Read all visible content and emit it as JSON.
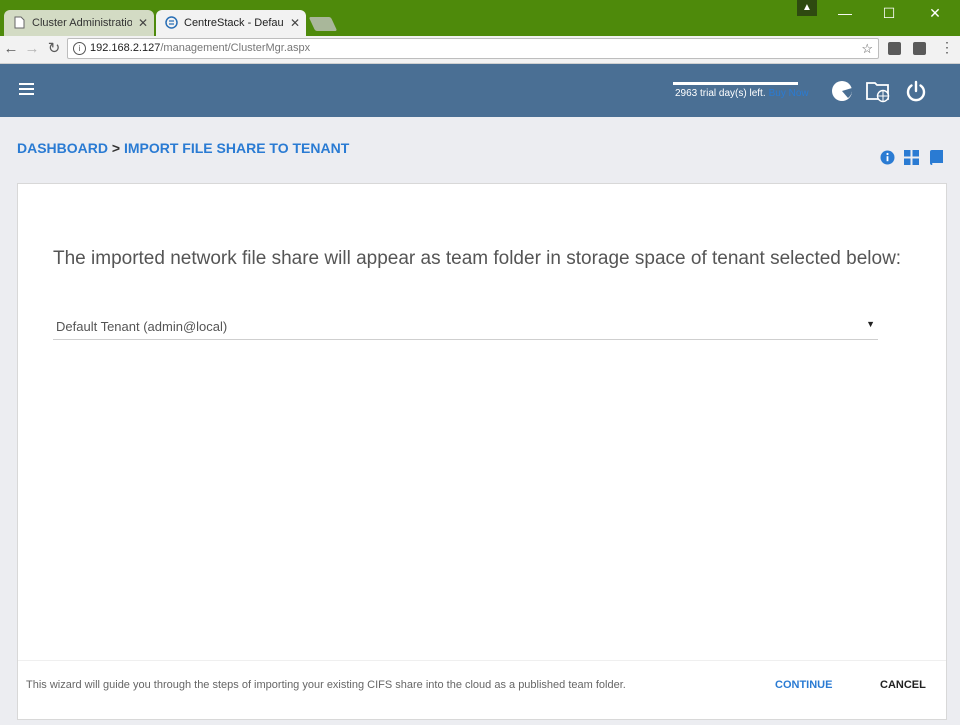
{
  "browser": {
    "tabs": [
      {
        "title": "Cluster Administration –",
        "active": false,
        "icon": "page-icon"
      },
      {
        "title": "CentreStack - Default Clu",
        "active": true,
        "icon": "centrestack-icon"
      }
    ],
    "address": {
      "host": "192.168.2.127",
      "path": "/management/ClusterMgr.aspx"
    }
  },
  "header": {
    "trial_text": "2963 trial day(s) left.",
    "trial_link": "Buy Now",
    "icons": [
      "report-icon",
      "folder-globe-icon",
      "power-icon"
    ]
  },
  "breadcrumb": {
    "root": "DASHBOARD",
    "separator": ">",
    "current": "IMPORT FILE SHARE TO TENANT"
  },
  "main": {
    "heading": "The imported network file share will appear as team folder in storage space of tenant selected below:",
    "tenant_select": {
      "value": "Default Tenant (admin@local)"
    }
  },
  "footer": {
    "note": "This wizard will guide you through the steps of importing your existing CIFS share into the cloud as a published team folder.",
    "continue_label": "CONTINUE",
    "cancel_label": "CANCEL"
  },
  "colors": {
    "titlebar": "#4e8a0b",
    "header": "#4a6f94",
    "accent": "#2a7bd3",
    "page_bg": "#ecedf1"
  }
}
